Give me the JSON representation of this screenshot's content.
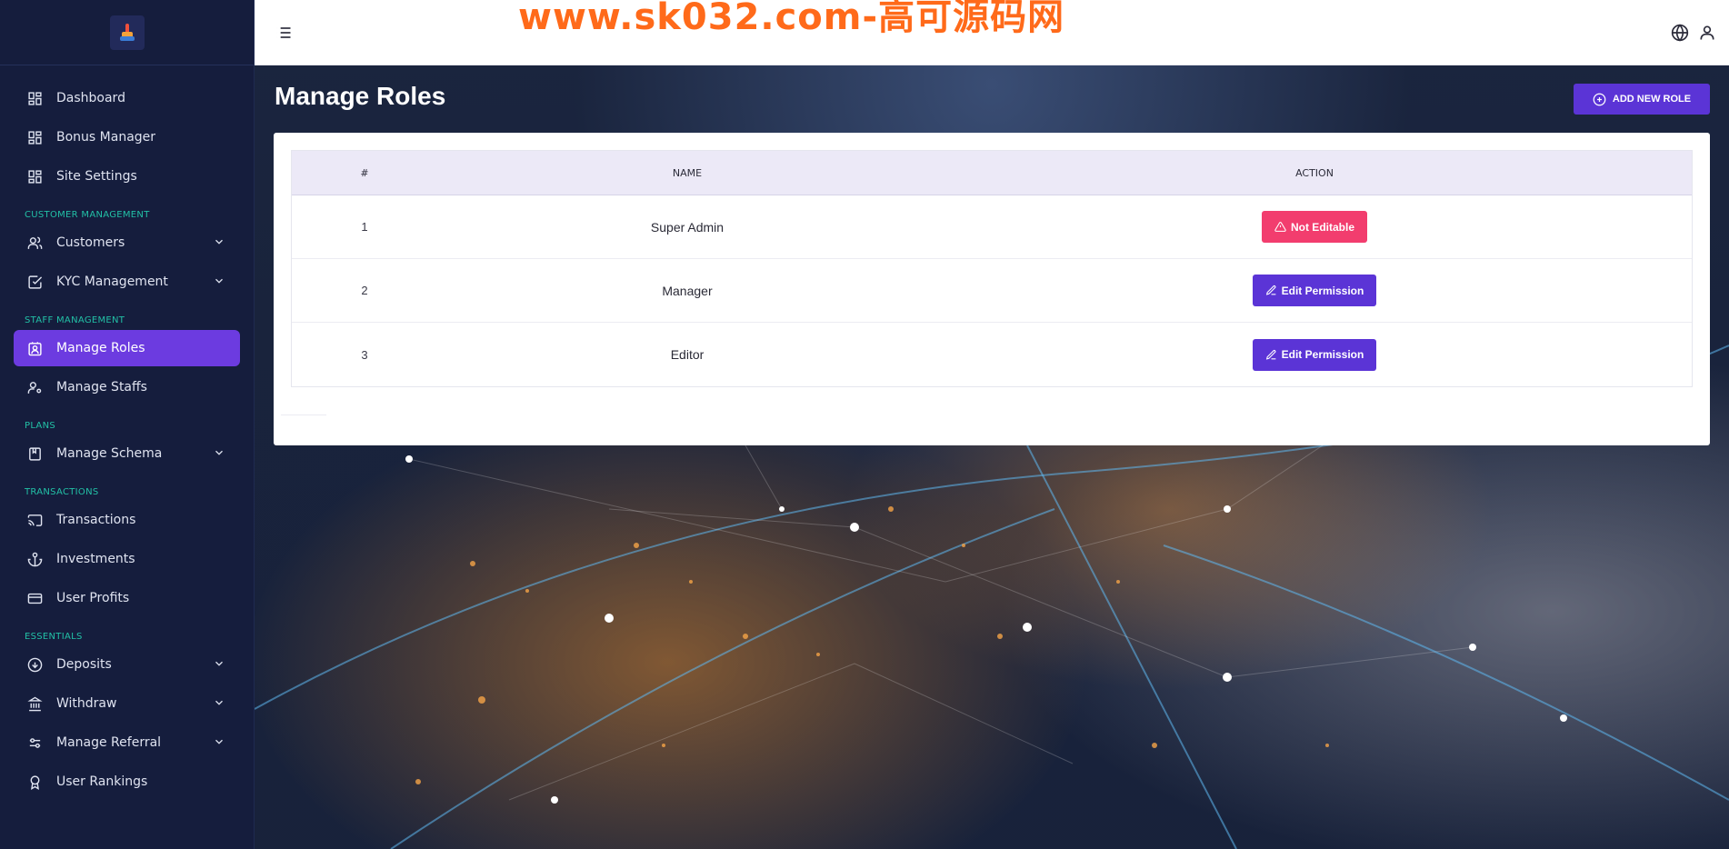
{
  "sidebar": {
    "items": [
      {
        "label": "Dashboard",
        "icon": "dashboard-icon"
      },
      {
        "label": "Bonus Manager",
        "icon": "dashboard-icon"
      },
      {
        "label": "Site Settings",
        "icon": "dashboard-icon"
      }
    ],
    "sections": [
      {
        "title": "CUSTOMER MANAGEMENT",
        "items": [
          {
            "label": "Customers",
            "icon": "users-icon",
            "expandable": true
          },
          {
            "label": "KYC Management",
            "icon": "check-square-icon",
            "expandable": true
          }
        ]
      },
      {
        "title": "STAFF MANAGEMENT",
        "items": [
          {
            "label": "Manage Roles",
            "icon": "contact-icon",
            "active": true
          },
          {
            "label": "Manage Staffs",
            "icon": "user-cog-icon"
          }
        ]
      },
      {
        "title": "PLANS",
        "items": [
          {
            "label": "Manage Schema",
            "icon": "book-icon",
            "expandable": true
          }
        ]
      },
      {
        "title": "TRANSACTIONS",
        "items": [
          {
            "label": "Transactions",
            "icon": "cast-icon"
          },
          {
            "label": "Investments",
            "icon": "anchor-icon"
          },
          {
            "label": "User Profits",
            "icon": "credit-card-icon"
          }
        ]
      },
      {
        "title": "ESSENTIALS",
        "items": [
          {
            "label": "Deposits",
            "icon": "arrow-down-circle-icon",
            "expandable": true
          },
          {
            "label": "Withdraw",
            "icon": "landmark-icon",
            "expandable": true
          },
          {
            "label": "Manage Referral",
            "icon": "settings-sliders-icon",
            "expandable": true
          },
          {
            "label": "User Rankings",
            "icon": "award-icon"
          }
        ]
      }
    ]
  },
  "topbar": {
    "watermark": "www.sk032.com-高可源码网"
  },
  "page": {
    "title": "Manage Roles",
    "add_button": "ADD NEW ROLE"
  },
  "table": {
    "headers": {
      "num": "#",
      "name": "NAME",
      "action": "ACTION"
    },
    "rows": [
      {
        "num": "1",
        "name": "Super Admin",
        "action": "Not Editable",
        "action_type": "locked"
      },
      {
        "num": "2",
        "name": "Manager",
        "action": "Edit Permission",
        "action_type": "edit"
      },
      {
        "num": "3",
        "name": "Editor",
        "action": "Edit Permission",
        "action_type": "edit"
      }
    ]
  },
  "colors": {
    "sidebar_bg": "#151d3d",
    "accent": "#6c3be0",
    "section_label": "#22c0a6",
    "danger": "#f23d6e",
    "header_row_bg": "#ece9f7"
  }
}
